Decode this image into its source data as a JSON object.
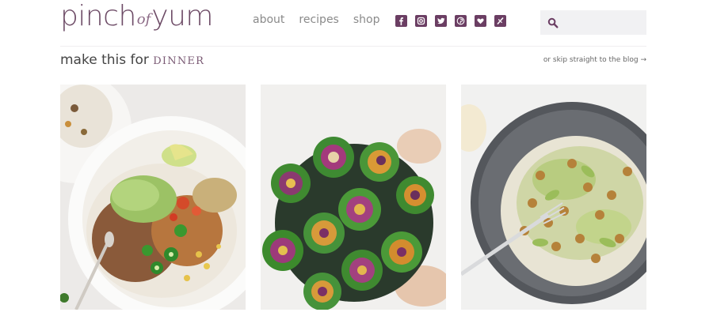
{
  "logo": {
    "part1": "pinch",
    "part2": "of",
    "part3": "yum"
  },
  "nav": [
    "about",
    "recipes",
    "shop"
  ],
  "social_icons": [
    "facebook-icon",
    "instagram-icon",
    "twitter-icon",
    "pinterest-icon",
    "bloglovin-icon",
    "rss-icon"
  ],
  "search": {
    "value": "",
    "placeholder": ""
  },
  "section": {
    "lead": "make this for",
    "accent": "DINNER",
    "skip_label": "or skip straight to the blog →"
  },
  "cards": [
    {
      "name": "taco-bowl"
    },
    {
      "name": "collard-wraps"
    },
    {
      "name": "chickpea-salad"
    }
  ],
  "colors": {
    "brand": "#6b3e63",
    "search_bg": "#f1f1f3"
  }
}
